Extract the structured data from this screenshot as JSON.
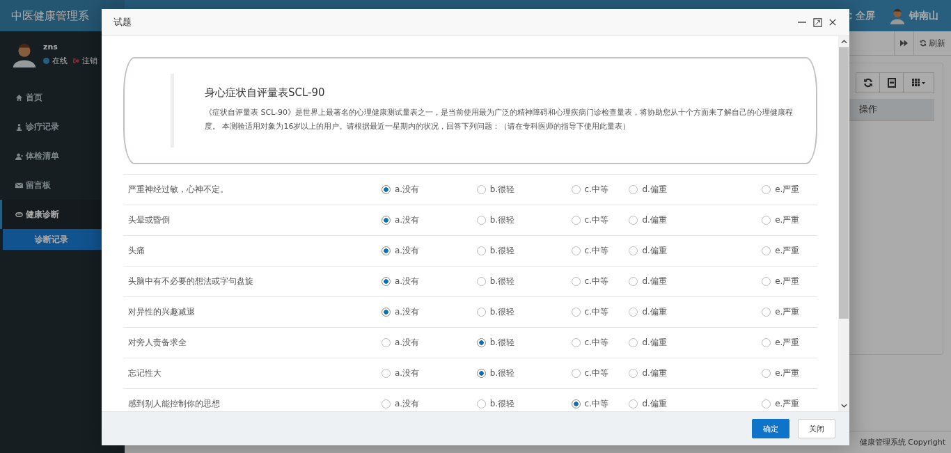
{
  "header": {
    "app_title": "中医健康管理系",
    "fullscreen": "全屏",
    "user_name": "钟南山"
  },
  "sidebar": {
    "user": {
      "name": "zns",
      "status": "在线",
      "logout": "注销"
    },
    "items": [
      {
        "label": "首页"
      },
      {
        "label": "诊疗记录"
      },
      {
        "label": "体检清单"
      },
      {
        "label": "留言板"
      },
      {
        "label": "健康诊断",
        "expanded": true,
        "children": [
          {
            "label": "诊断记录",
            "selected": true
          }
        ]
      }
    ]
  },
  "toolbar": {
    "refresh": "刷新"
  },
  "table": {
    "columns": [
      "操作"
    ]
  },
  "footer": {
    "copyright": "健康管理系统 Copyright"
  },
  "dialog": {
    "title": "试题",
    "intro": {
      "title": "身心症状自评量表SCL-90",
      "text": "《症状自评量表 SCL-90》是世界上最著名的心理健康测试量表之一，是当前使用最为广泛的精神障碍和心理疾病门诊检查量表，将协助您从十个方面来了解自己的心理健康程度。 本测验适用对象为16岁以上的用户。请根据最近一星期内的状况，回答下列问题：（请在专科医师的指导下使用此量表）"
    },
    "questions": [
      {
        "text": "严重神经过敏，心神不定。",
        "options": [
          {
            "label": "a.没有",
            "selected": true
          },
          {
            "label": "b.很轻",
            "selected": false
          },
          {
            "label": "c.中等",
            "selected": false
          },
          {
            "label": "d.偏重",
            "selected": false
          },
          {
            "label": "e.严重",
            "selected": false
          }
        ]
      },
      {
        "text": "头晕或昏倒",
        "options": [
          {
            "label": "a.没有",
            "selected": true
          },
          {
            "label": "b.很轻",
            "selected": false
          },
          {
            "label": "c.中等",
            "selected": false
          },
          {
            "label": "d.偏重",
            "selected": false
          },
          {
            "label": "e.严重",
            "selected": false
          }
        ]
      },
      {
        "text": "头痛",
        "options": [
          {
            "label": "a.没有",
            "selected": true
          },
          {
            "label": "b.很轻",
            "selected": false
          },
          {
            "label": "c.中等",
            "selected": false
          },
          {
            "label": "d.偏重",
            "selected": false
          },
          {
            "label": "e.严重",
            "selected": false
          }
        ]
      },
      {
        "text": "头脑中有不必要的想法或字句盘旋",
        "options": [
          {
            "label": "a.没有",
            "selected": true
          },
          {
            "label": "b.很轻",
            "selected": false
          },
          {
            "label": "c.中等",
            "selected": false
          },
          {
            "label": "d.偏重",
            "selected": false
          },
          {
            "label": "e.严重",
            "selected": false
          }
        ]
      },
      {
        "text": "对异性的兴趣减退",
        "options": [
          {
            "label": "a.没有",
            "selected": true
          },
          {
            "label": "b.很轻",
            "selected": false
          },
          {
            "label": "c.中等",
            "selected": false
          },
          {
            "label": "d.偏重",
            "selected": false
          },
          {
            "label": "e.严重",
            "selected": false
          }
        ]
      },
      {
        "text": "对旁人责备求全",
        "options": [
          {
            "label": "a.没有",
            "selected": false
          },
          {
            "label": "b.很轻",
            "selected": true
          },
          {
            "label": "c.中等",
            "selected": false
          },
          {
            "label": "d.偏重",
            "selected": false
          },
          {
            "label": "e.严重",
            "selected": false
          }
        ]
      },
      {
        "text": "忘记性大",
        "options": [
          {
            "label": "a.没有",
            "selected": false
          },
          {
            "label": "b.很轻",
            "selected": true
          },
          {
            "label": "c.中等",
            "selected": false
          },
          {
            "label": "d.偏重",
            "selected": false
          },
          {
            "label": "e.严重",
            "selected": false
          }
        ]
      },
      {
        "text": "感到别人能控制你的思想",
        "options": [
          {
            "label": "a.没有",
            "selected": false
          },
          {
            "label": "b.很轻",
            "selected": false
          },
          {
            "label": "c.中等",
            "selected": true
          },
          {
            "label": "d.偏重",
            "selected": false
          },
          {
            "label": "e.严重",
            "selected": false
          }
        ]
      }
    ],
    "buttons": [
      {
        "label": "确定",
        "kind": "primary"
      },
      {
        "label": "关闭",
        "kind": "default"
      }
    ]
  }
}
